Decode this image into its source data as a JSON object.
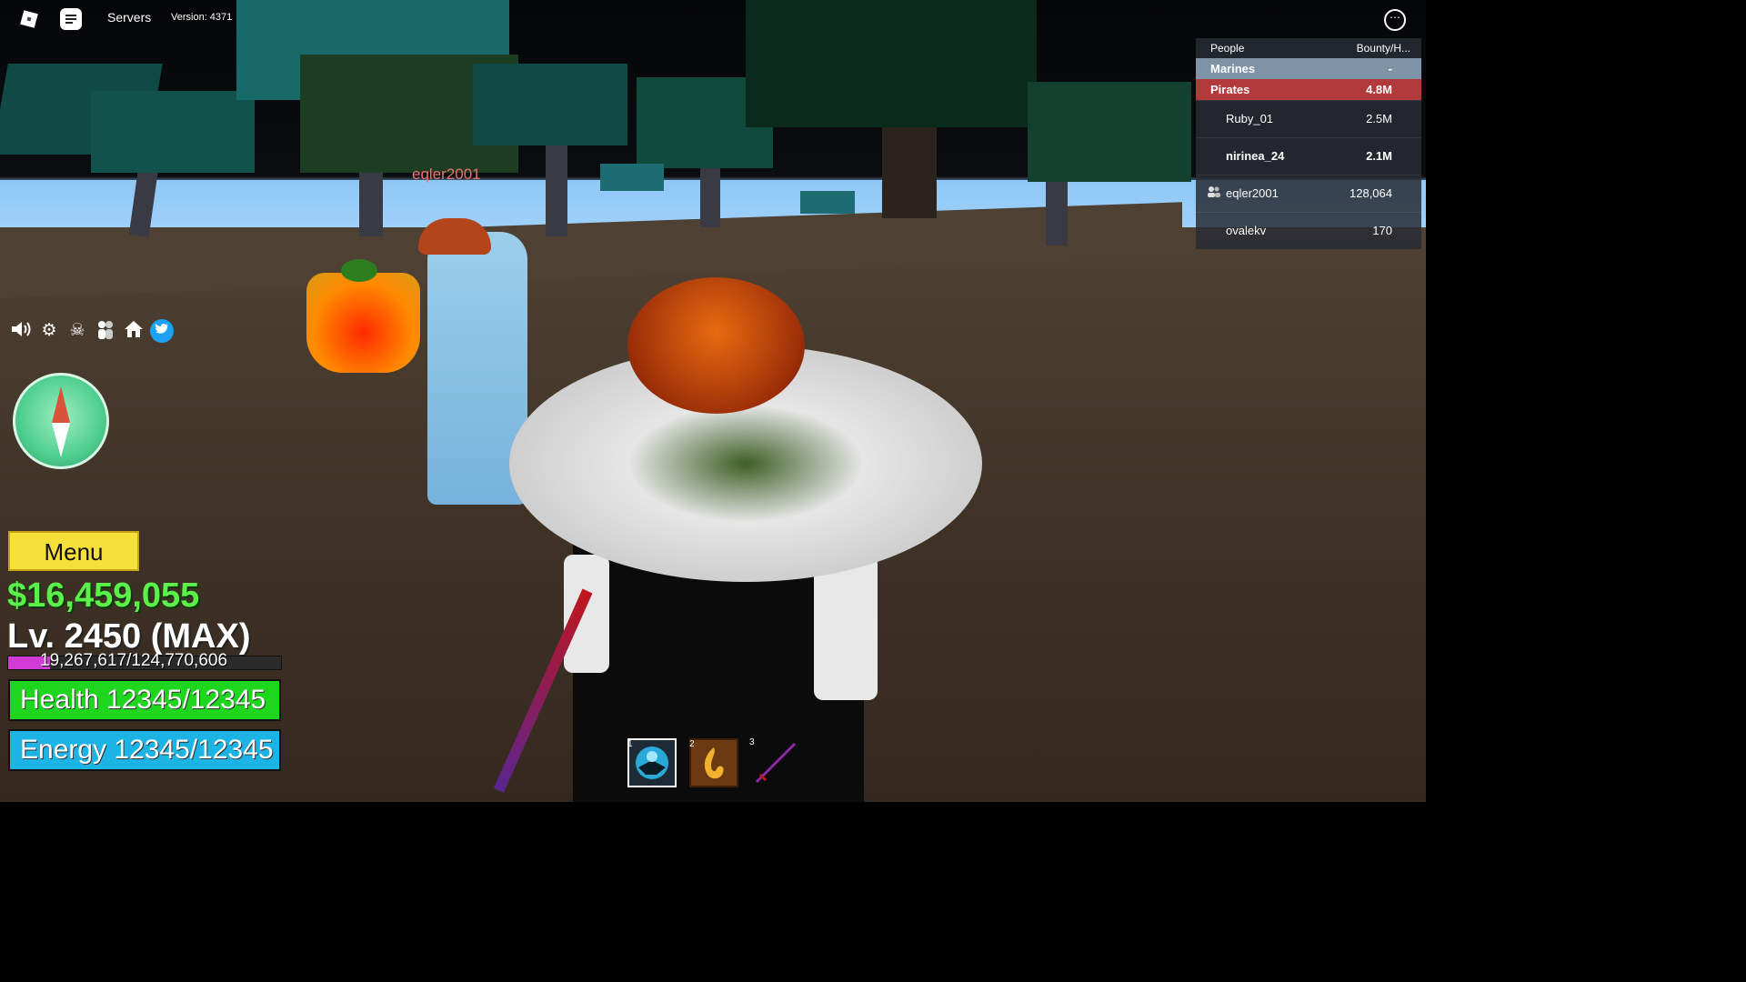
{
  "topbar": {
    "servers_label": "Servers",
    "version_label": "Version: 4371",
    "roblox_icon": "roblox-logo-icon",
    "chat_icon": "chat-icon",
    "more_icon": "more-options-icon"
  },
  "leaderboard": {
    "header": {
      "label": "People",
      "column": "Bounty/H..."
    },
    "teams": [
      {
        "name": "Marines",
        "value": "-",
        "color": "#7f93a7"
      },
      {
        "name": "Pirates",
        "value": "4.8M",
        "color": "#b33a3a"
      }
    ],
    "players": [
      {
        "name": "Ruby_01",
        "value": "2.5M"
      },
      {
        "name": "nirinea_24",
        "value": "2.1M"
      },
      {
        "name": "eqler2001",
        "value": "128,064"
      },
      {
        "name": "ovalekv",
        "value": "170"
      }
    ]
  },
  "toolbar": {
    "icons": [
      "speaker-icon",
      "gear-icon",
      "pirate-flag-icon",
      "crew-icon",
      "home-icon",
      "twitter-icon"
    ]
  },
  "nametag": "eqler2001",
  "stats": {
    "menu_label": "Menu",
    "money": "$16,459,055",
    "level": "Lv. 2450 (MAX)",
    "xp_text": "19,267,617/124,770,606",
    "xp_fraction": 0.154,
    "health": "Health 12345/12345",
    "energy": "Energy 12345/12345",
    "health_color": "#1fd61f",
    "energy_color": "#1bb4e5",
    "money_color": "#5cf04a"
  },
  "hotbar": {
    "slots": [
      {
        "number": "1",
        "icon": "fighting-style-icon"
      },
      {
        "number": "2",
        "icon": "fruit-icon"
      },
      {
        "number": "3",
        "icon": "sword-icon"
      }
    ]
  }
}
